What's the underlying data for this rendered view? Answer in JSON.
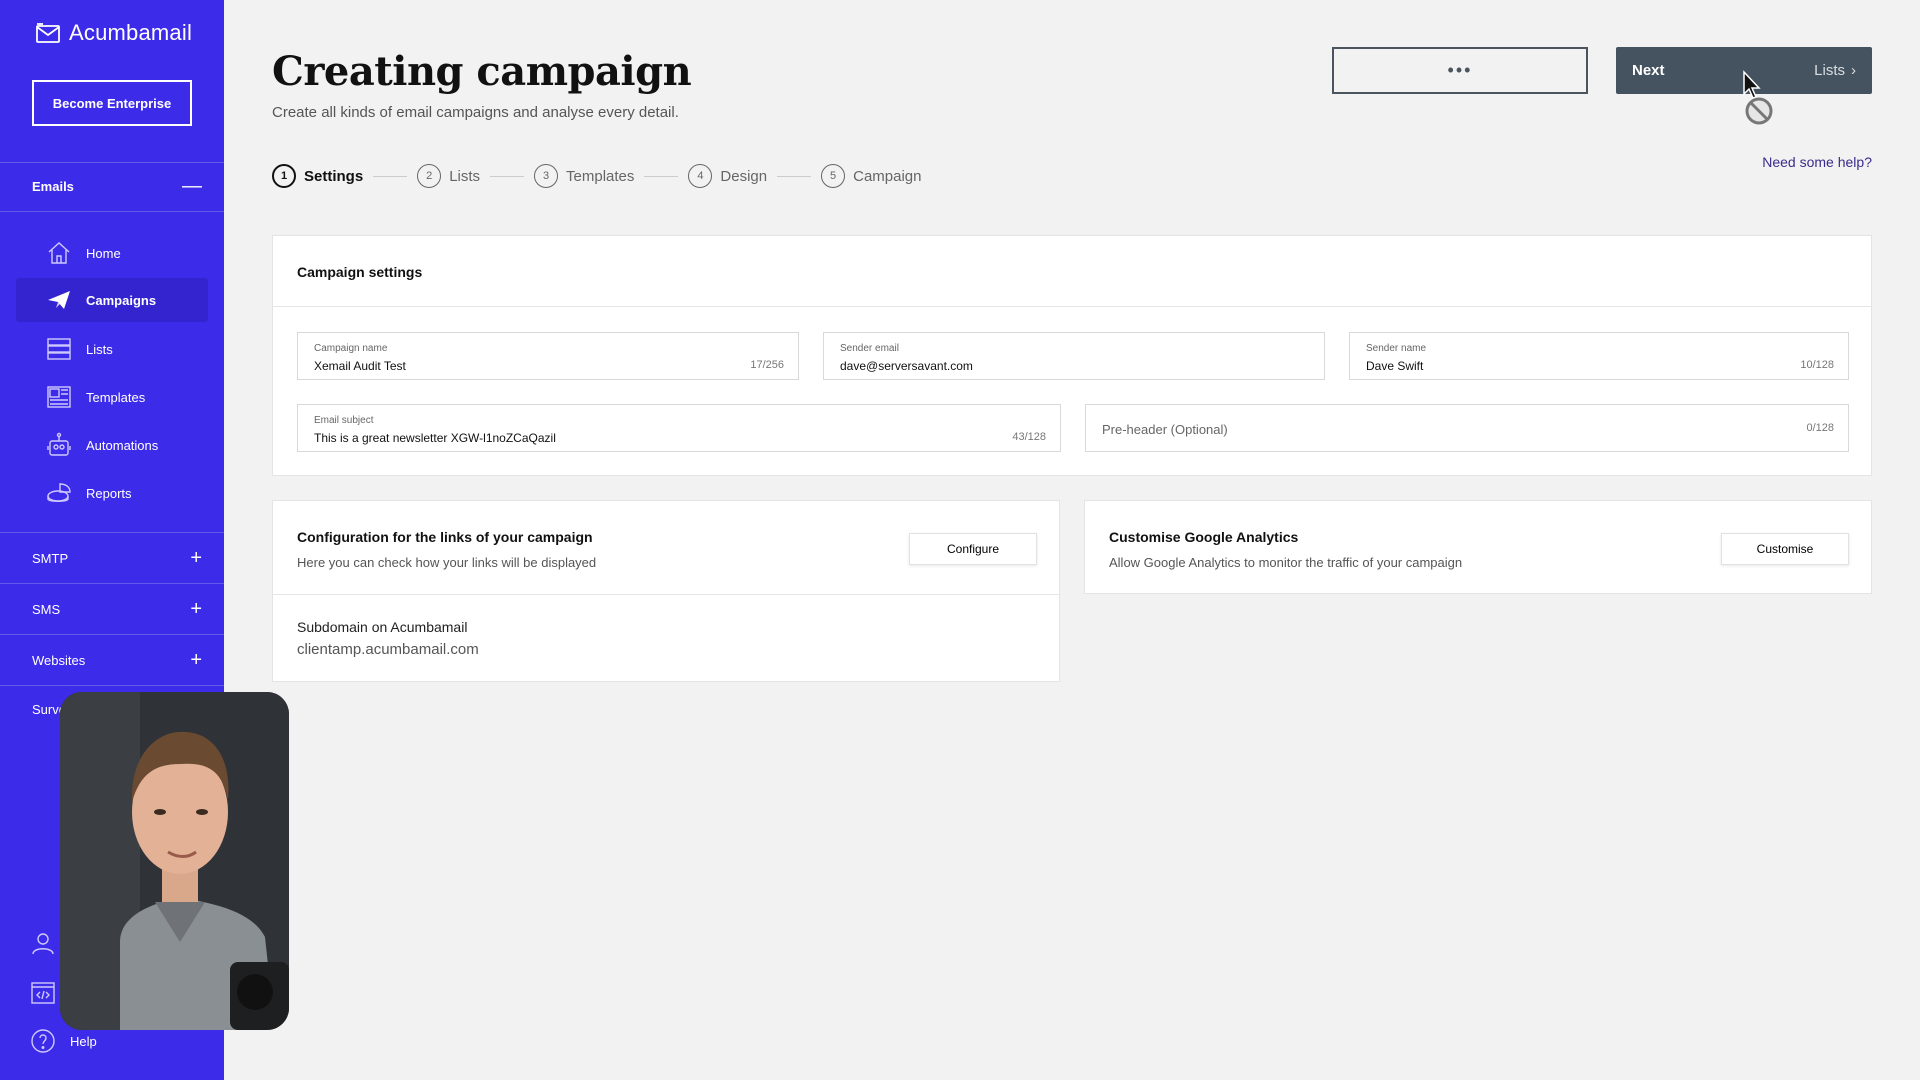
{
  "app": {
    "name": "Acumbamail",
    "enterprise_button": "Become Enterprise"
  },
  "sidebar": {
    "emails_section": "Emails",
    "items": [
      {
        "label": "Home",
        "icon": "home-icon"
      },
      {
        "label": "Campaigns",
        "icon": "paper-plane-icon",
        "active": true
      },
      {
        "label": "Lists",
        "icon": "list-icon"
      },
      {
        "label": "Templates",
        "icon": "templates-icon"
      },
      {
        "label": "Automations",
        "icon": "robot-icon"
      },
      {
        "label": "Reports",
        "icon": "pie-chart-icon"
      }
    ],
    "sections": [
      {
        "label": "SMTP"
      },
      {
        "label": "SMS"
      },
      {
        "label": "Websites"
      },
      {
        "label": "Surve"
      }
    ],
    "help_label": "Help"
  },
  "header": {
    "title": "Creating campaign",
    "subtitle": "Create all kinds of email campaigns and analyse every detail.",
    "more_button": "•••",
    "next_label": "Next",
    "next_target": "Lists",
    "help_link": "Need some help?"
  },
  "stepper": [
    {
      "num": "1",
      "label": "Settings",
      "active": true
    },
    {
      "num": "2",
      "label": "Lists"
    },
    {
      "num": "3",
      "label": "Templates"
    },
    {
      "num": "4",
      "label": "Design"
    },
    {
      "num": "5",
      "label": "Campaign"
    }
  ],
  "campaign_settings": {
    "title": "Campaign settings",
    "campaign_name": {
      "label": "Campaign name",
      "value": "Xemail Audit Test",
      "count": "17/256"
    },
    "sender_email": {
      "label": "Sender email",
      "value": "dave@serversavant.com"
    },
    "sender_name": {
      "label": "Sender name",
      "value": "Dave Swift",
      "count": "10/128"
    },
    "email_subject": {
      "label": "Email subject",
      "value": "This is a great newsletter XGW-l1noZCaQazil",
      "count": "43/128"
    },
    "preheader": {
      "placeholder": "Pre-header (Optional)",
      "count": "0/128"
    }
  },
  "links_config": {
    "title": "Configuration for the links of your campaign",
    "description": "Here you can check how your links will be displayed",
    "button": "Configure",
    "subdomain_label": "Subdomain on Acumbamail",
    "subdomain_value": "clientamp.acumbamail.com"
  },
  "analytics": {
    "title": "Customise Google Analytics",
    "description": "Allow Google Analytics to monitor the traffic of your campaign",
    "button": "Customise"
  },
  "colors": {
    "sidebar": "#3d2bea",
    "sidebar_active": "#3424d0",
    "next_button": "#455360",
    "background": "#f2f2f2"
  }
}
